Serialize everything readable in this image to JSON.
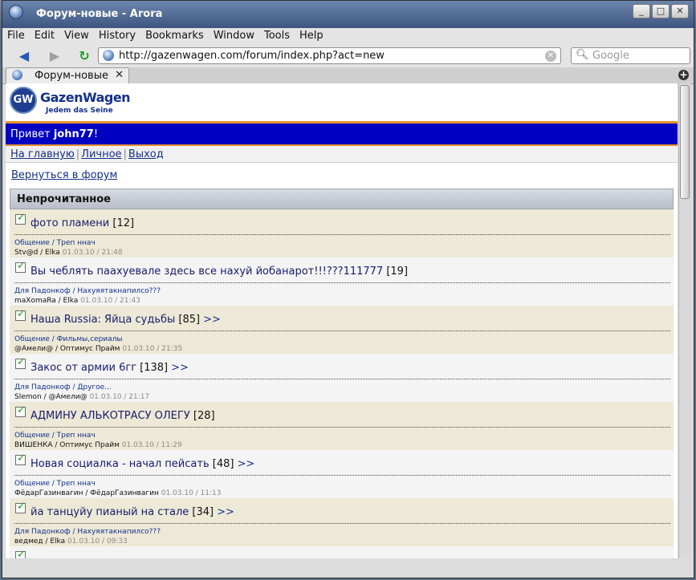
{
  "window": {
    "title": "Форум-новые - Arora"
  },
  "menu": [
    "File",
    "Edit",
    "View",
    "History",
    "Bookmarks",
    "Window",
    "Tools",
    "Help"
  ],
  "nav": {
    "url": "http://gazenwagen.com/forum/index.php?act=new",
    "search_placeholder": "Google"
  },
  "tab": {
    "label": "Форум-новые"
  },
  "site": {
    "logo_text": "GazenWagen",
    "slogan": "Jedem das Seine",
    "greeting_prefix": "Привет ",
    "username": "john77",
    "greeting_suffix": "!",
    "links": [
      "На главную",
      "Личное",
      "Выход"
    ],
    "back_link": "Вернуться в форум",
    "section_title": "Непрочитанное"
  },
  "topics": [
    {
      "title": "фото пламени",
      "count": "[12]",
      "more": "",
      "category": "Общение / Треп ннач",
      "users": "Stv@d / Elka",
      "date": "01.03.10 / 21:48"
    },
    {
      "title": "Вы чеблять паахуевале здесь все нахуй йобанарот!!!???111777",
      "count": "[19]",
      "more": "",
      "category": "Для Падонкоф / Нахуяятакнапилсо???",
      "users": "maXomaRa / Elka",
      "date": "01.03.10 / 21:43"
    },
    {
      "title": "Наша Russia: Яйца судьбы",
      "count": "[85]",
      "more": ">>",
      "category": "Общение / Фильмы,сериалы",
      "users": "@Амели@ / Оптимус Прайм",
      "date": "01.03.10 / 21:35"
    },
    {
      "title": "Закос от армии 6гг",
      "count": "[138]",
      "more": ">>",
      "category": "Для Падонкоф / Другое...",
      "users": "Slemon / @Амели@",
      "date": "01.03.10 / 21:17"
    },
    {
      "title": "АДМИНУ АЛЬКОТРАСУ ОЛЕГУ",
      "count": "[28]",
      "more": "",
      "category": "Общение / Треп ннач",
      "users": "ВИШЕНКА / Оптимус Прайм",
      "date": "01.03.10 / 11:29"
    },
    {
      "title": "Новая социалка - начал пейсать",
      "count": "[48]",
      "more": ">>",
      "category": "Общение / Треп ннач",
      "users": "ФёдарГазинвагин / ФёдарГазинвагин",
      "date": "01.03.10 / 11:13"
    },
    {
      "title": "йа танцуйу пианый на стале",
      "count": "[34]",
      "more": ">>",
      "category": "Для Падонкоф / Нахуяятакнапилсо???",
      "users": "ведмед / Elka",
      "date": "01.03.10 / 09:33"
    },
    {
      "title": "",
      "count": "",
      "more": "",
      "category": "",
      "users": "",
      "date": ""
    }
  ]
}
